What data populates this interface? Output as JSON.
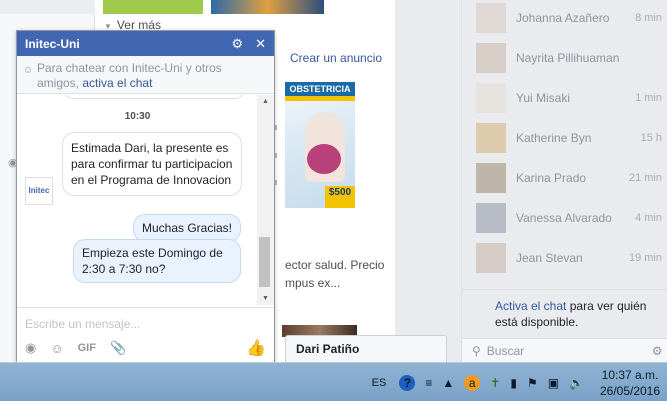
{
  "feed": {
    "ver_mas": "Ver más",
    "crear_anuncio": "Crear un anuncio",
    "ad": {
      "headline": "OBSTETRICIA",
      "price": "$500",
      "text_line1": "ector salud. Precio",
      "text_line2": "mpus ex..."
    }
  },
  "chat": {
    "title": "Initec-Uni",
    "notice_prefix": "Para chatear con Initec-Uni y otros amigos,",
    "notice_link": "activa el chat",
    "time": "10:30",
    "avatar_label": "Initec",
    "incoming": "Estimada Dari, la presente es para confirmar tu participacion en el Programa de Innovacion",
    "outgoing1": "Muchas Gracias!",
    "outgoing2": "Empieza este Domingo de 2:30 a 7:30 no?",
    "compose_placeholder": "Escribe un mensaje...",
    "gif_label": "GIF"
  },
  "chat_tab": {
    "name": "Dari Patiño"
  },
  "sidebar": {
    "contacts": [
      {
        "name": "Johanna Azañero",
        "time": "8 min",
        "color": "#d8c8c0"
      },
      {
        "name": "Nayrita Pillihuaman",
        "time": "",
        "color": "#c8b6aa"
      },
      {
        "name": "Yui Misaki",
        "time": "1 min",
        "color": "#e6dcd2"
      },
      {
        "name": "Katherine Byn",
        "time": "15 h",
        "color": "#d6b07a"
      },
      {
        "name": "Karina Prado",
        "time": "21 min",
        "color": "#9b8a70"
      },
      {
        "name": "Vanessa Alvarado",
        "time": "4 min",
        "color": "#8e96a6"
      },
      {
        "name": "Jean Stevan",
        "time": "19 min",
        "color": "#c4b2a8"
      }
    ],
    "notice_link": "Activa el chat",
    "notice_rest": "para ver quién está disponible.",
    "search_placeholder": "Buscar"
  },
  "taskbar": {
    "language": "ES",
    "time": "10:37 a.m.",
    "date": "26/05/2016"
  },
  "colors": {
    "facebook_blue": "#4267b2",
    "link_blue": "#365899",
    "outgoing_bubble": "#e9f2fd"
  }
}
